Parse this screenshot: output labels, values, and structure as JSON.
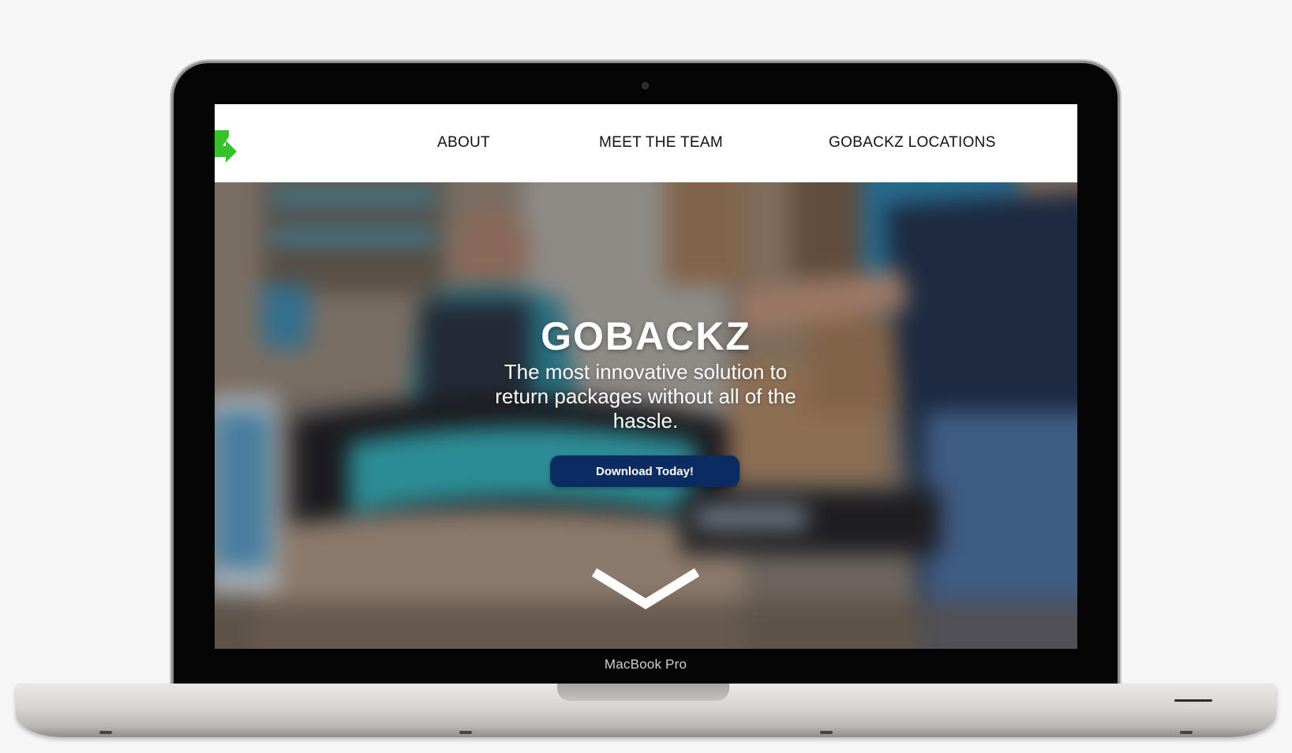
{
  "device": {
    "model_label": "MacBook Pro"
  },
  "nav": {
    "logo_icon": "green-arrow-logo-icon",
    "links": [
      {
        "label": "ABOUT"
      },
      {
        "label": "MEET THE TEAM"
      },
      {
        "label": "GOBACKZ LOCATIONS"
      }
    ]
  },
  "hero": {
    "title": "GOBACKZ",
    "subtitle": "The most innovative solution to return packages without all of the hassle.",
    "cta_label": "Download Today!",
    "scroll_icon": "chevron-down-icon"
  },
  "colors": {
    "brand_green": "#35c22a",
    "cta_navy": "#0b2b63",
    "nav_background": "#ffffff",
    "text_on_hero": "#ffffff"
  }
}
